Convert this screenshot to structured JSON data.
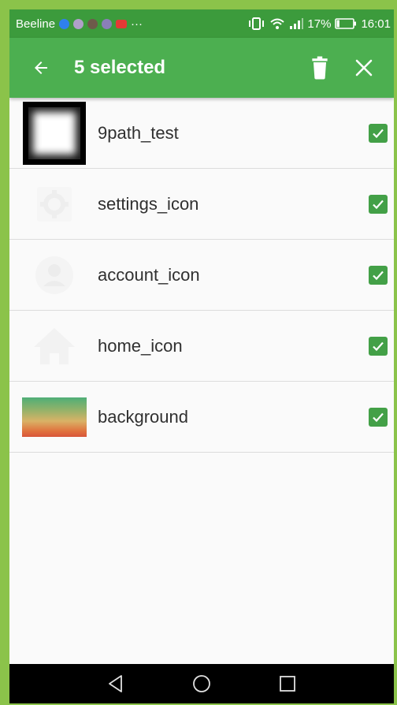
{
  "status_bar": {
    "carrier": "Beeline",
    "more_notifications": "···",
    "battery_percent": "17%",
    "battery_level": 0.17,
    "time": "16:01",
    "icons": [
      "vibrate-icon",
      "wifi-icon",
      "signal-icon",
      "battery-icon"
    ]
  },
  "app_bar": {
    "title": "5 selected",
    "icons": [
      "back-arrow-icon",
      "delete-icon",
      "close-icon"
    ]
  },
  "items": [
    {
      "label": "9path_test",
      "checked": true
    },
    {
      "label": "settings_icon",
      "checked": true
    },
    {
      "label": "account_icon",
      "checked": true
    },
    {
      "label": "home_icon",
      "checked": true
    },
    {
      "label": "background",
      "checked": true
    }
  ],
  "nav_bar": {
    "icons": [
      "back-triangle-icon",
      "home-circle-icon",
      "recents-square-icon"
    ]
  },
  "colors": {
    "app_bar": "#4caf50",
    "status_bar": "#3c9b3c",
    "checkbox": "#43a047",
    "frame": "#8bc34a"
  }
}
